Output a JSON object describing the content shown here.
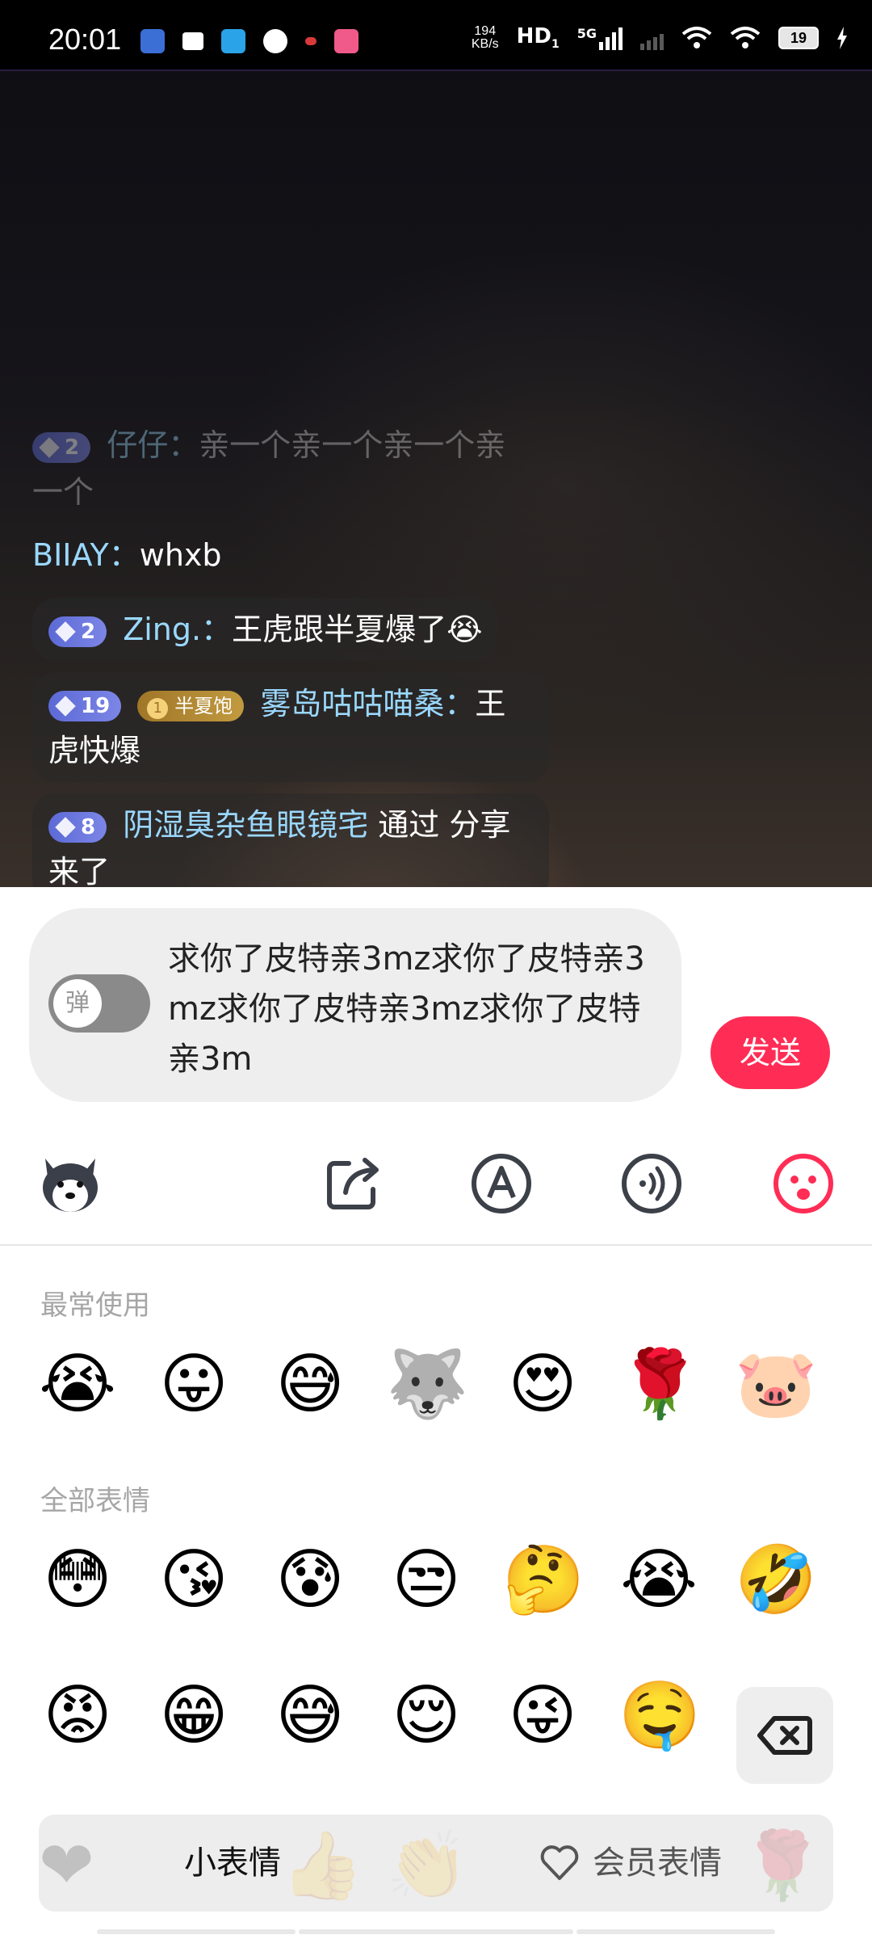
{
  "status_bar": {
    "time": "20:01",
    "net_speed_value": "194",
    "net_speed_unit": "KB/s",
    "hd_label": "HD",
    "hd_sub": "1",
    "network": "5G",
    "battery": "19"
  },
  "chat": {
    "messages": [
      {
        "level": "2",
        "user": "仔仔：",
        "text": "亲一个亲一个亲一个亲一个"
      },
      {
        "user": "BIIAY：",
        "text": "whxb"
      },
      {
        "level": "2",
        "user": "Zing.：",
        "text": "王虎跟半夏爆了😭"
      },
      {
        "level": "19",
        "fan_badge_num": "1",
        "fan_badge": "半夏饱",
        "user": "雾岛咕咕喵桑：",
        "text": "王虎快爆"
      },
      {
        "level": "8",
        "user": "阴湿臭杂鱼眼镜宅",
        "text": " 通过 分享 来了"
      }
    ]
  },
  "input": {
    "toggle_label": "弹",
    "value": "求你了皮特亲3mz求你了皮特亲3mz求你了皮特亲3mz求你了皮特亲3m",
    "send_label": "发送"
  },
  "emoji_panel": {
    "frequent_title": "最常使用",
    "frequent": [
      "😭",
      "😛",
      "😅",
      "🐺",
      "😍",
      "🌹",
      "🐷"
    ],
    "all_title": "全部表情",
    "all_row1": [
      "😳",
      "😘",
      "😰",
      "😒",
      "🤔",
      "😭",
      "🤣"
    ],
    "all_row2": [
      "😡",
      "😁",
      "😅",
      "😌",
      "😜",
      "🤤"
    ]
  },
  "tabs": {
    "small_label": "小表情",
    "member_label": "会员表情"
  },
  "colors": {
    "accent": "#ff2d55",
    "username": "#9ad8ff",
    "badge_blue": "#6a76de",
    "badge_gold": "#b08832"
  },
  "icons": [
    "husky-sticker-icon",
    "share-icon",
    "text-style-icon",
    "voice-icon",
    "emoji-face-icon",
    "backspace-icon",
    "heart-outline-icon"
  ]
}
